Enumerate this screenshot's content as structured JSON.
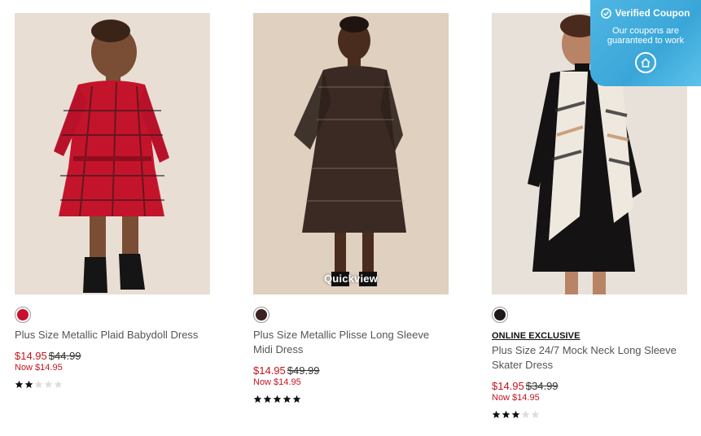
{
  "products": [
    {
      "name": "Plus Size Metallic Plaid Babydoll Dress",
      "sale_price": "$14.95",
      "original_price": "$44.99",
      "now_price": "Now $14.95",
      "swatch_color": "#c8102e",
      "rating": 2,
      "badge": ""
    },
    {
      "name": "Plus Size Metallic Plisse Long Sleeve Midi Dress",
      "sale_price": "$14.95",
      "original_price": "$49.99",
      "now_price": "Now $14.95",
      "swatch_color": "#3a2320",
      "rating": 5,
      "badge": "",
      "overlay_label": "Quickview"
    },
    {
      "name": "Plus Size 24/7 Mock Neck Long Sleeve Skater Dress",
      "sale_price": "$14.95",
      "original_price": "$34.99",
      "now_price": "Now $14.95",
      "swatch_color": "#1e1a1b",
      "rating": 3,
      "badge": "ONLINE EXCLUSIVE"
    }
  ],
  "coupon": {
    "title": "Verified Coupon",
    "subtitle": "Our coupons are guaranteed to work",
    "icon": "check-circle-icon",
    "logo_icon": "house-logo-icon"
  },
  "colors": {
    "sale": "#c4141f",
    "coupon_bg": "#3aa6d8",
    "star_filled": "#111111",
    "star_empty": "#dddddd"
  }
}
